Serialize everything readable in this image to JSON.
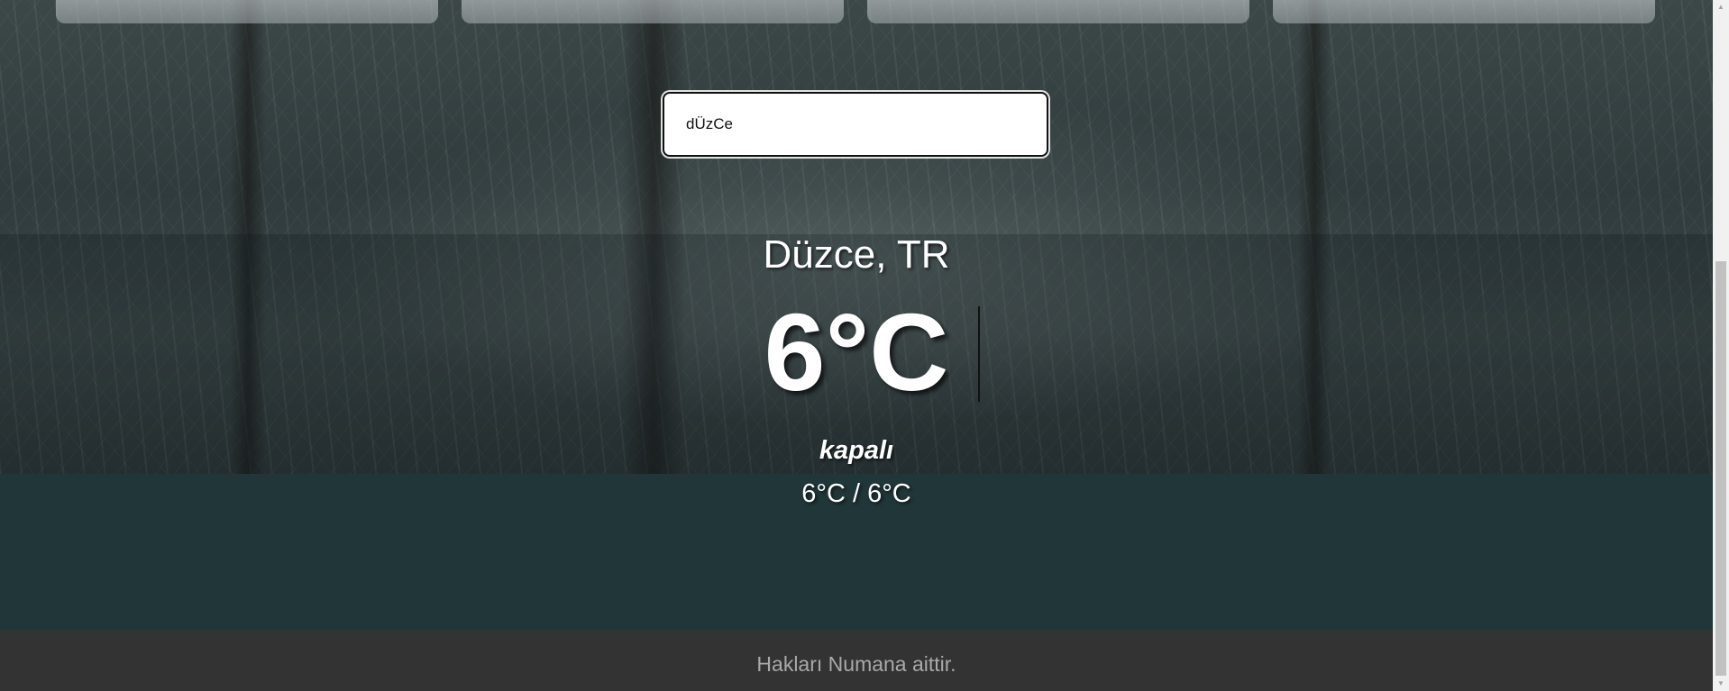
{
  "search": {
    "value": "dÜzCe"
  },
  "weather": {
    "location": "Düzce, TR",
    "temperature": "6°C",
    "description": "kapalı",
    "min_max": "6°C / 6°C"
  },
  "footer": {
    "text": "Hakları Numana aittir."
  },
  "icons": {
    "scroll_up": "scroll-up-icon",
    "scroll_down": "scroll-down-icon"
  }
}
